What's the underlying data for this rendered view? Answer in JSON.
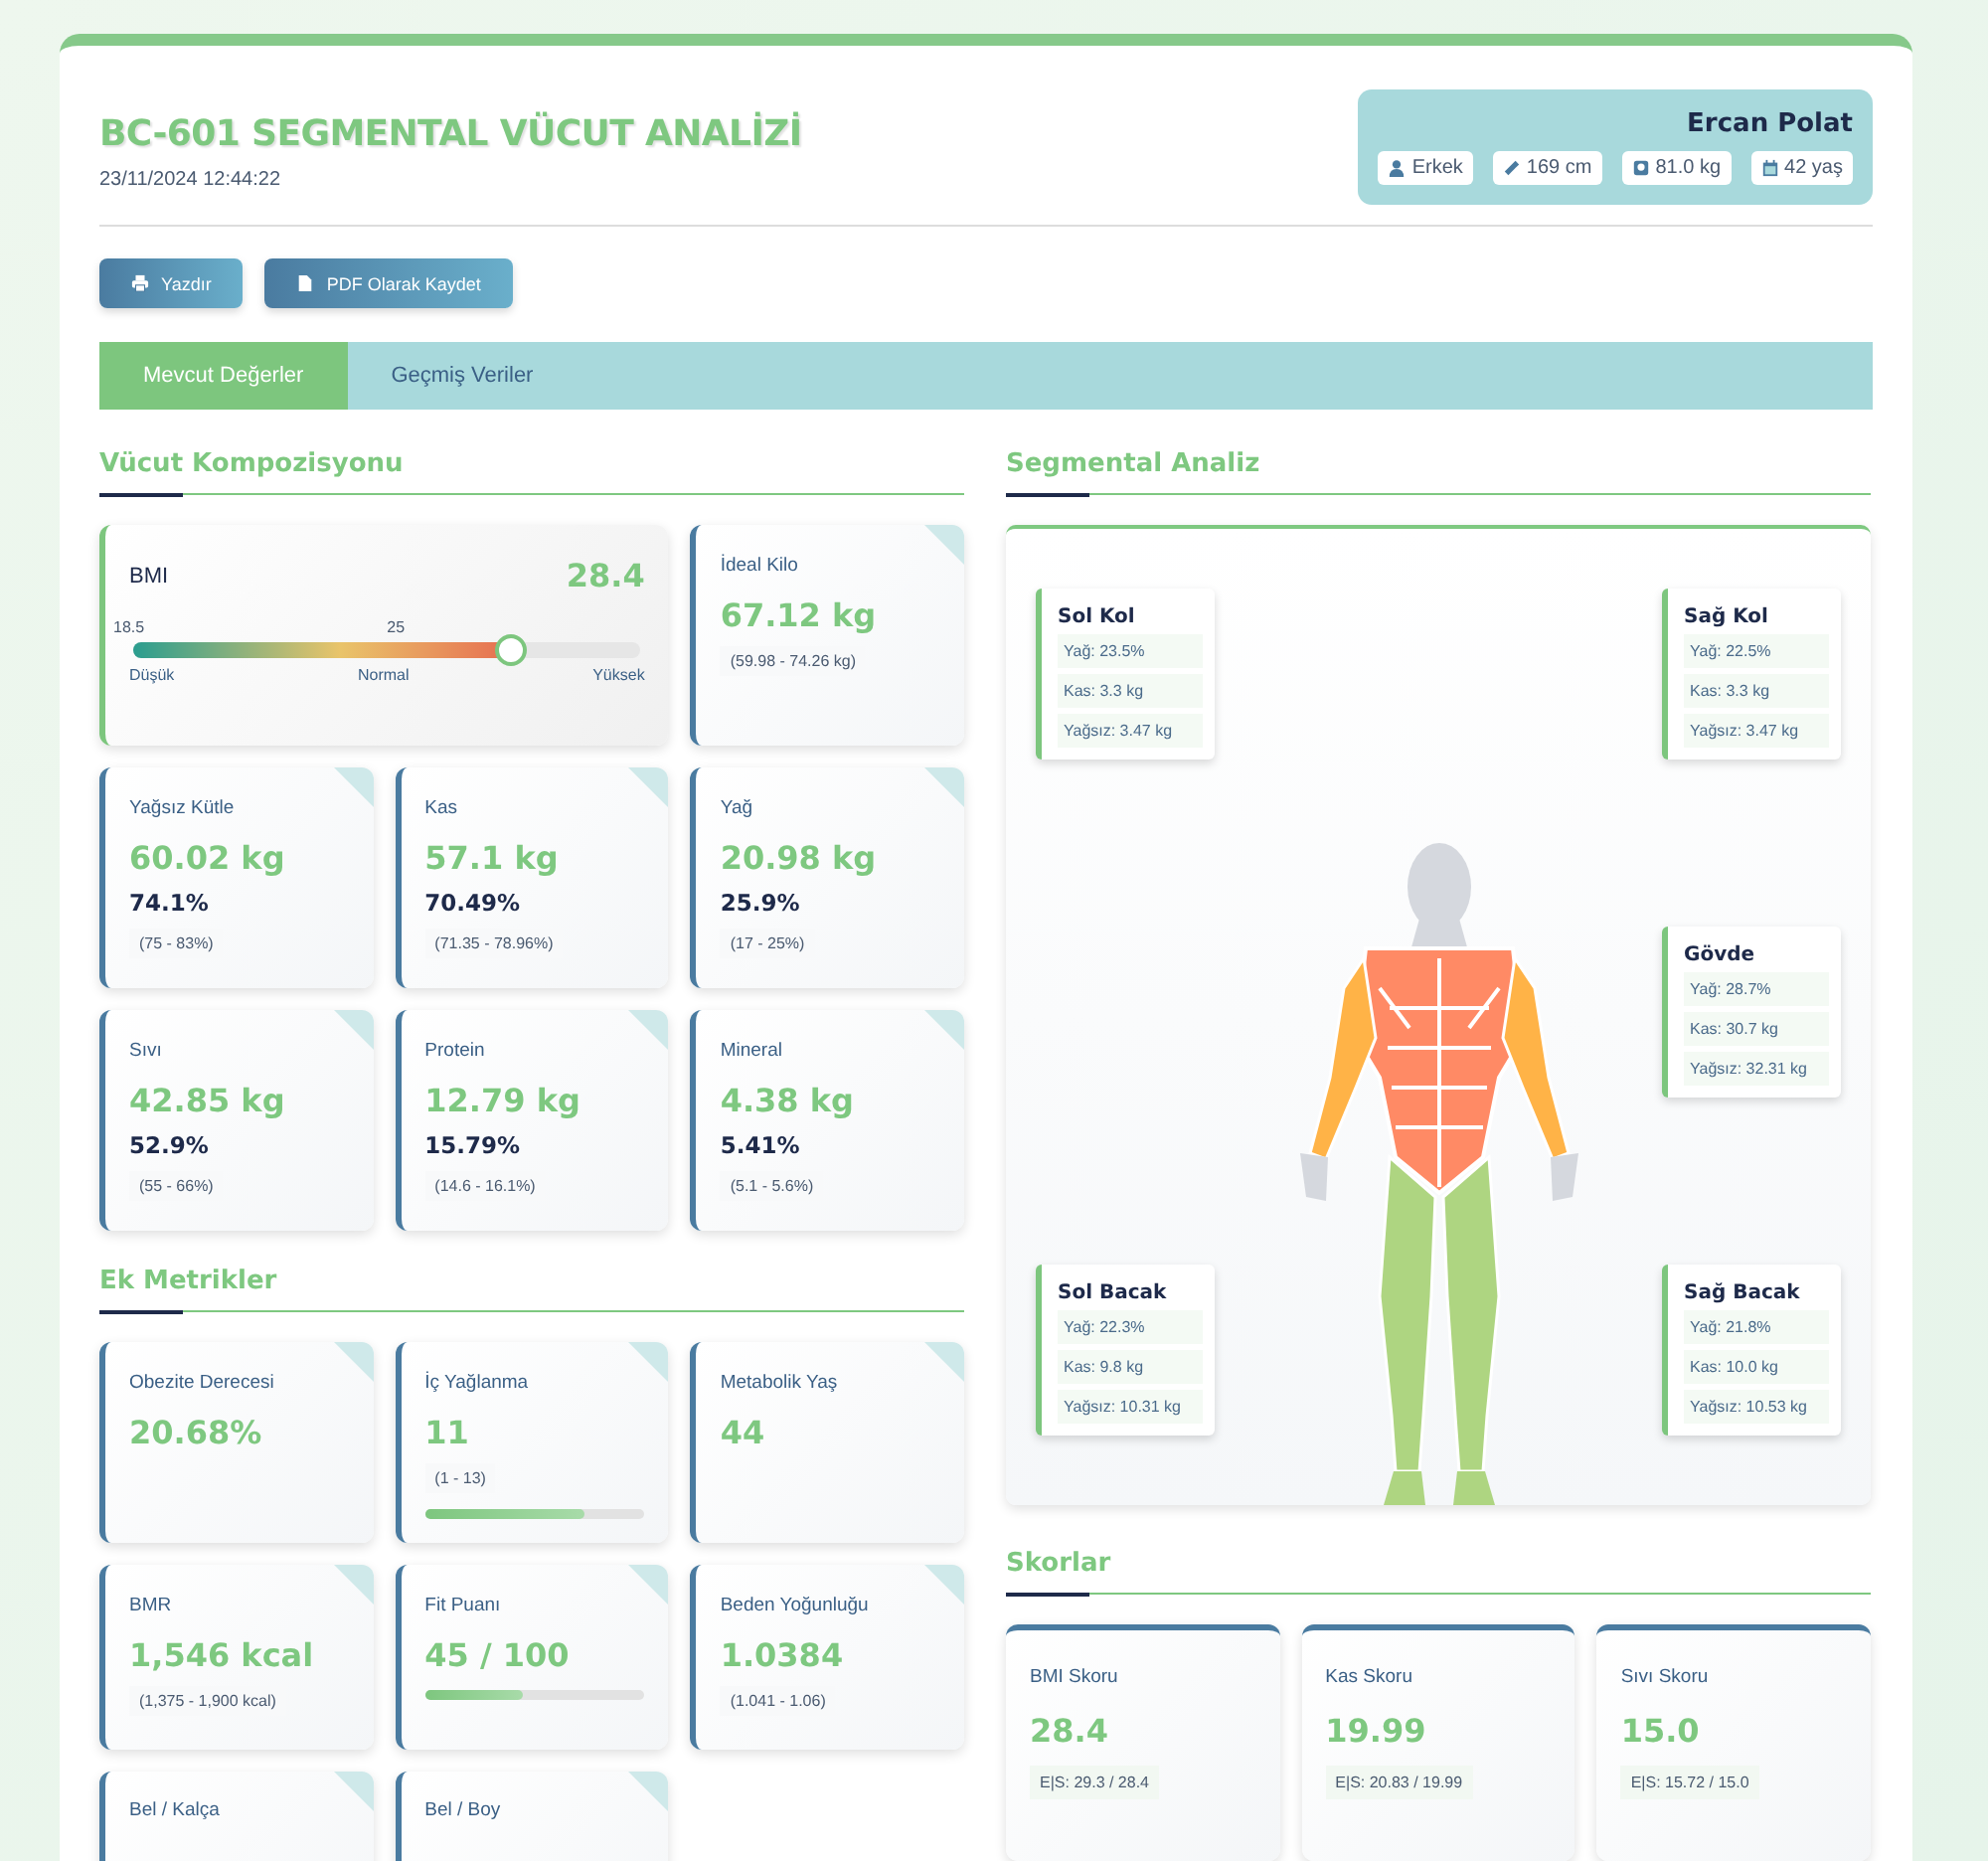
{
  "header": {
    "title": "BC-601 SEGMENTAL VÜCUT ANALİZİ",
    "datetime": "23/11/2024 12:44:22"
  },
  "user": {
    "name": "Ercan Polat",
    "chips": [
      {
        "kind": "gender",
        "text": "Erkek"
      },
      {
        "kind": "height",
        "text": "169 cm"
      },
      {
        "kind": "weight",
        "text": "81.0 kg"
      },
      {
        "kind": "age",
        "text": "42 yaş"
      }
    ]
  },
  "buttons": [
    {
      "kind": "print",
      "label": "Yazdır"
    },
    {
      "kind": "pdf",
      "label": "PDF Olarak Kaydet"
    }
  ],
  "tabs": [
    {
      "label": "Mevcut Değerler",
      "selected": true
    },
    {
      "label": "Geçmiş Veriler",
      "selected": false
    }
  ],
  "composition": {
    "title": "Vücut Kompozisyonu",
    "bmi": {
      "label": "BMI",
      "value": "28.4",
      "ticks": [
        "18.5",
        "25"
      ],
      "scale_labels": [
        "Düşük",
        "Normal",
        "Yüksek"
      ],
      "level": 0.74
    },
    "ideal": {
      "label": "İdeal Kilo",
      "value": "67.12 kg",
      "range": "(59.98 - 74.26 kg)"
    },
    "cards": [
      {
        "label": "Yağsız Kütle",
        "value": "60.02 kg",
        "percent": "74.1%",
        "range": "(75 - 83%)"
      },
      {
        "label": "Kas",
        "value": "57.1 kg",
        "percent": "70.49%",
        "range": "(71.35 - 78.96%)"
      },
      {
        "label": "Yağ",
        "value": "20.98 kg",
        "percent": "25.9%",
        "range": "(17 - 25%)"
      },
      {
        "label": "Sıvı",
        "value": "42.85 kg",
        "percent": "52.9%",
        "range": "(55 - 66%)"
      },
      {
        "label": "Protein",
        "value": "12.79 kg",
        "percent": "15.79%",
        "range": "(14.6 - 16.1%)"
      },
      {
        "label": "Mineral",
        "value": "4.38 kg",
        "percent": "5.41%",
        "range": "(5.1 - 5.6%)"
      }
    ]
  },
  "extra": {
    "title": "Ek Metrikler",
    "cards": [
      {
        "label": "Obezite Derecesi",
        "value": "20.68%"
      },
      {
        "label": "İç Yağlanma",
        "value": "11",
        "range": "(1 - 13)",
        "level": 0.73
      },
      {
        "label": "Metabolik Yaş",
        "value": "44"
      },
      {
        "label": "BMR",
        "value": "1,546 kcal",
        "range": "(1,375 - 1,900 kcal)"
      },
      {
        "label": "Fit Puanı",
        "value": "45 / 100",
        "level": 0.45
      },
      {
        "label": "Beden Yoğunluğu",
        "value": "1.0384",
        "range": "(1.041 - 1.06)"
      },
      {
        "label": "Bel / Kalça"
      },
      {
        "label": "Bel / Boy"
      }
    ]
  },
  "segmental": {
    "title": "Segmental Analiz",
    "segments": [
      {
        "name": "Sol Kol",
        "rows": [
          "Yağ: 23.5%",
          "Kas: 3.3 kg",
          "Yağsız: 3.47 kg"
        ]
      },
      {
        "name": "Sağ Kol",
        "rows": [
          "Yağ: 22.5%",
          "Kas: 3.3 kg",
          "Yağsız: 3.47 kg"
        ]
      },
      {
        "name": "Gövde",
        "rows": [
          "Yağ: 28.7%",
          "Kas: 30.7 kg",
          "Yağsız: 32.31 kg"
        ]
      },
      {
        "name": "Sol Bacak",
        "rows": [
          "Yağ: 22.3%",
          "Kas: 9.8 kg",
          "Yağsız: 10.31 kg"
        ]
      },
      {
        "name": "Sağ Bacak",
        "rows": [
          "Yağ: 21.8%",
          "Kas: 10.0 kg",
          "Yağsız: 10.53 kg"
        ]
      }
    ]
  },
  "scores": {
    "title": "Skorlar",
    "cards": [
      {
        "label": "BMI Skoru",
        "value": "28.4",
        "detail": "E|S: 29.3 / 28.4"
      },
      {
        "label": "Kas Skoru",
        "value": "19.99",
        "detail": "E|S: 20.83 / 19.99"
      },
      {
        "label": "Sıvı Skoru",
        "value": "15.0",
        "detail": "E|S: 15.72 / 15.0"
      }
    ]
  }
}
